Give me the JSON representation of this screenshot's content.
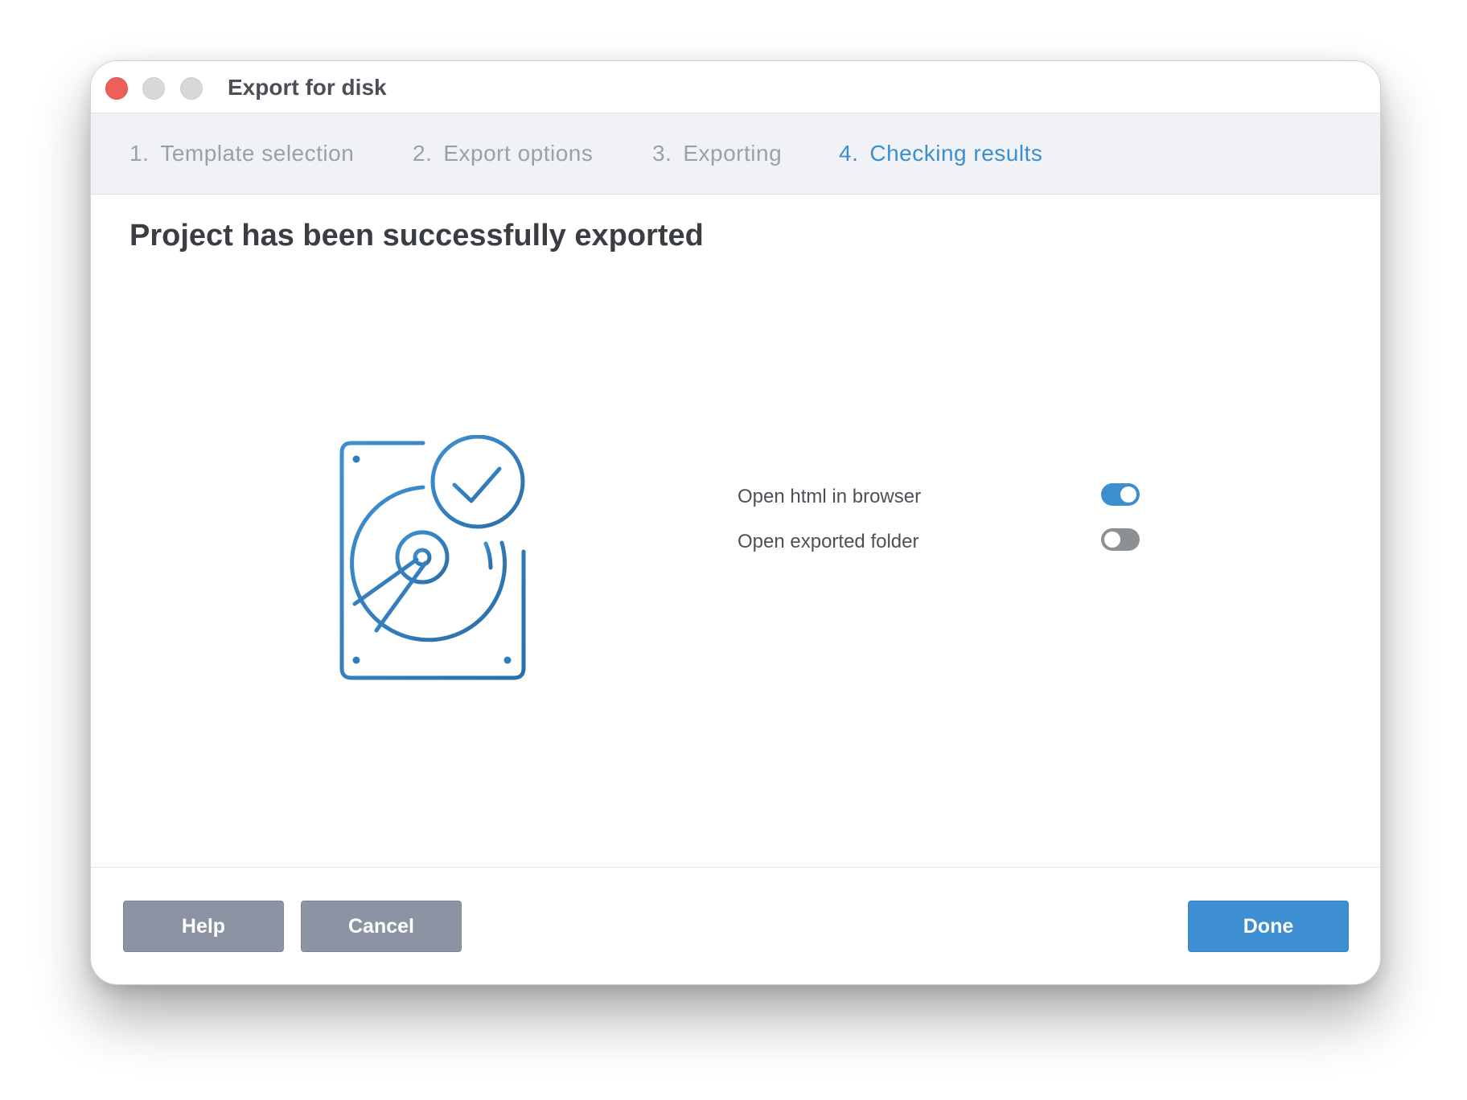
{
  "window": {
    "title": "Export for disk"
  },
  "steps": [
    {
      "number": "1.",
      "label": "Template selection",
      "active": false
    },
    {
      "number": "2.",
      "label": "Export options",
      "active": false
    },
    {
      "number": "3.",
      "label": "Exporting",
      "active": false
    },
    {
      "number": "4.",
      "label": "Checking results",
      "active": true
    }
  ],
  "main": {
    "heading": "Project has been successfully exported",
    "illustration_icon": "hard-drive-check-icon"
  },
  "options": [
    {
      "label": "Open html in browser",
      "enabled": true
    },
    {
      "label": "Open exported folder",
      "enabled": false
    }
  ],
  "footer": {
    "help_label": "Help",
    "cancel_label": "Cancel",
    "done_label": "Done"
  },
  "colors": {
    "accent": "#3b8fcf",
    "close_light": "#ec5f5b",
    "button_grey": "#8c94a3",
    "button_primary": "#3d8fd1"
  }
}
